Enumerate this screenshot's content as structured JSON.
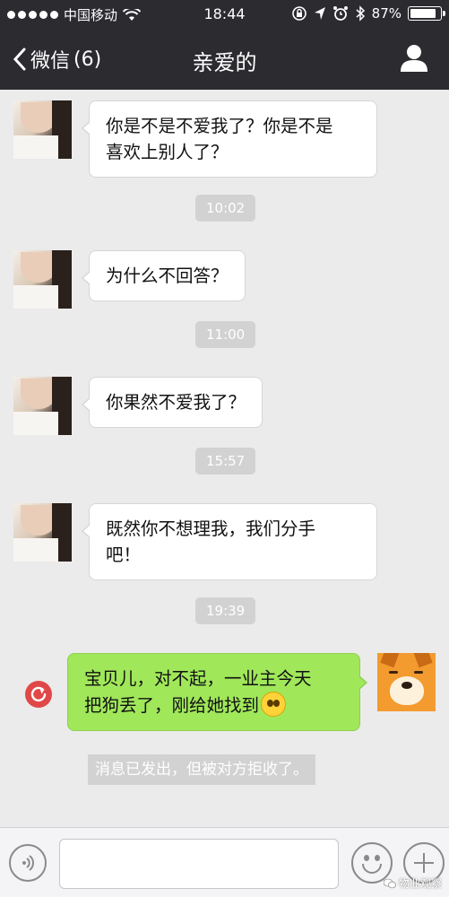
{
  "status_bar": {
    "carrier": "中国移动",
    "time": "18:44",
    "battery": "87%",
    "battery_level": 0.87
  },
  "nav": {
    "back_label": "微信",
    "unread_count": "(6)",
    "title": "亲爱的"
  },
  "messages": [
    {
      "side": "left",
      "text_line1": "你是不是不爱我了？你是不是",
      "text_line2": "喜欢上别人了？"
    },
    {
      "side": "left",
      "text": "为什么不回答？"
    },
    {
      "side": "left",
      "text": "你果然不爱我了？"
    },
    {
      "side": "left",
      "text_line1": "既然你不想理我，我们分手",
      "text_line2": "吧！"
    },
    {
      "side": "right",
      "text_line1": "宝贝儿，对不起，一业主今天",
      "text_line2": "把狗丢了，刚给她找到"
    }
  ],
  "timestamps": [
    "10:02",
    "11:00",
    "15:57",
    "19:39"
  ],
  "system_notice": "消息已发出，但被对方拒收了。",
  "input": {
    "value": ""
  },
  "watermark": "物业观察",
  "colors": {
    "topbar": "#2b2b30",
    "chat_bg": "#ebebeb",
    "sent_bubble": "#a0e75a",
    "received_bubble": "#ffffff",
    "resend_icon": "#e04848"
  }
}
